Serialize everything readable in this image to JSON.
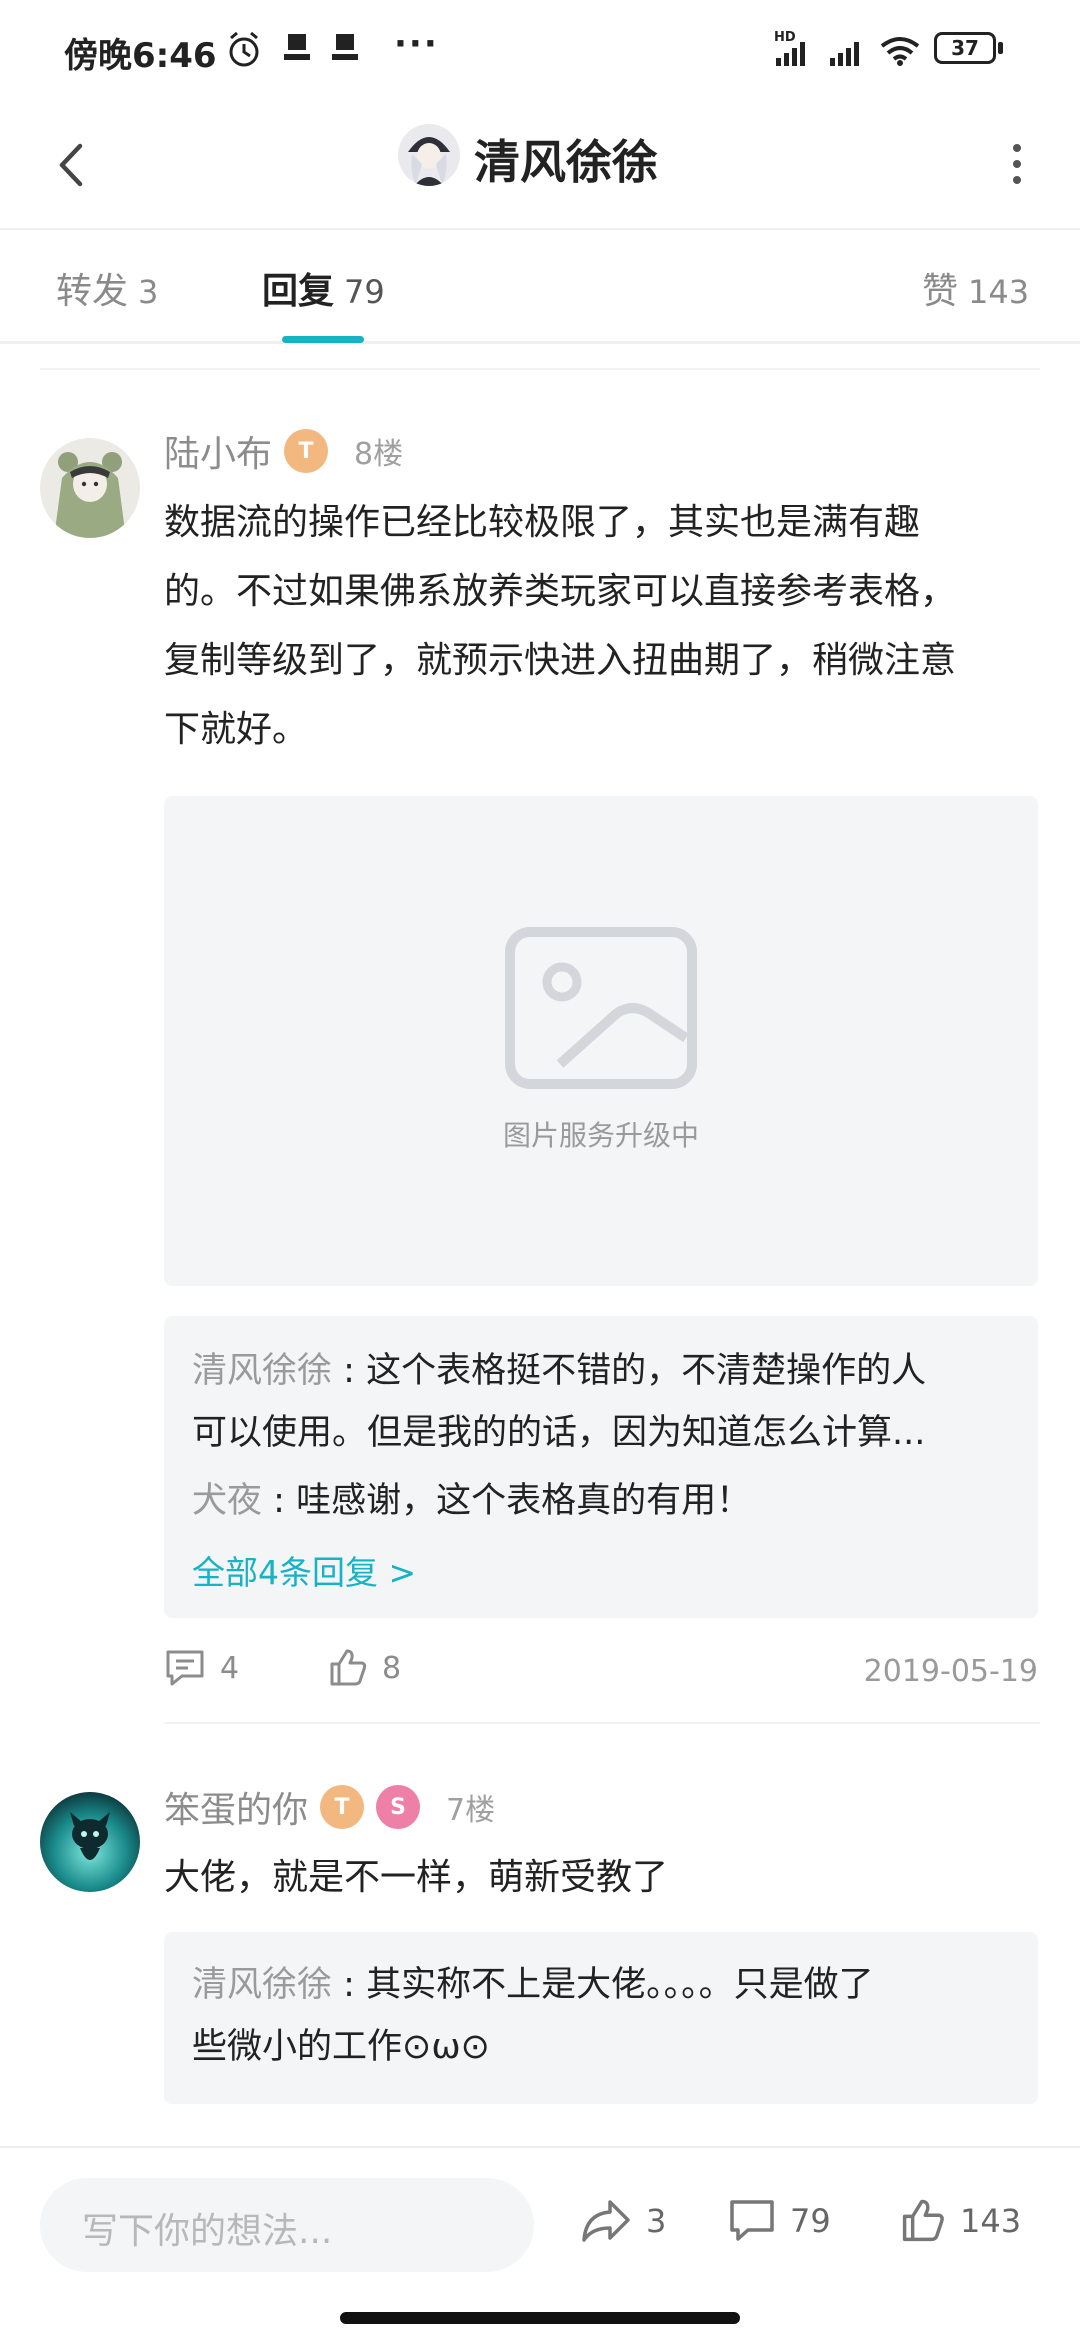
{
  "status_bar": {
    "time": "傍晚6:46",
    "dots": "···",
    "battery": "37",
    "network": "HD"
  },
  "header": {
    "title": "清风徐徐"
  },
  "tabs": [
    {
      "label": "转发",
      "count": "3"
    },
    {
      "label": "回复",
      "count": "79"
    },
    {
      "label": "赞",
      "count": "143"
    }
  ],
  "comments": [
    {
      "username": "陆小布",
      "badges": [
        "T"
      ],
      "floor": "8楼",
      "text_lines": [
        "数据流的操作已经比较极限了，其实也是满有趣",
        "的。不过如果佛系放养类玩家可以直接参考表格，",
        "复制等级到了，就预示快进入扭曲期了，稍微注意",
        "下就好。"
      ],
      "image_caption": "图片服务升级中",
      "replies": [
        {
          "author": "清风徐徐",
          "sep": " : ",
          "text_line1": "这个表格挺不错的，不清楚操作的人",
          "text_line2": "可以使用。但是我的的话，因为知道怎么计算..."
        },
        {
          "author": "犬夜",
          "sep": " : ",
          "text": "哇感谢，这个表格真的有用！"
        }
      ],
      "view_all": "全部4条回复 >",
      "reply_count": "4",
      "like_count": "8",
      "date": "2019-05-19"
    },
    {
      "username": "笨蛋的你",
      "badges": [
        "T",
        "S"
      ],
      "floor": "7楼",
      "text": "大佬，就是不一样，萌新受教了",
      "replies": [
        {
          "author": "清风徐徐",
          "sep": " : ",
          "text_line1": "其实称不上是大佬。。。。只是做了",
          "text_line2": "些微小的工作⊙ω⊙"
        }
      ]
    }
  ],
  "bottom_bar": {
    "placeholder": "写下你的想法...",
    "forward_count": "3",
    "comment_count": "79",
    "like_count": "143"
  },
  "colors": {
    "accent": "#15b3c4",
    "muted_text": "#8c8c8c",
    "panel_bg": "#f4f5f7"
  }
}
